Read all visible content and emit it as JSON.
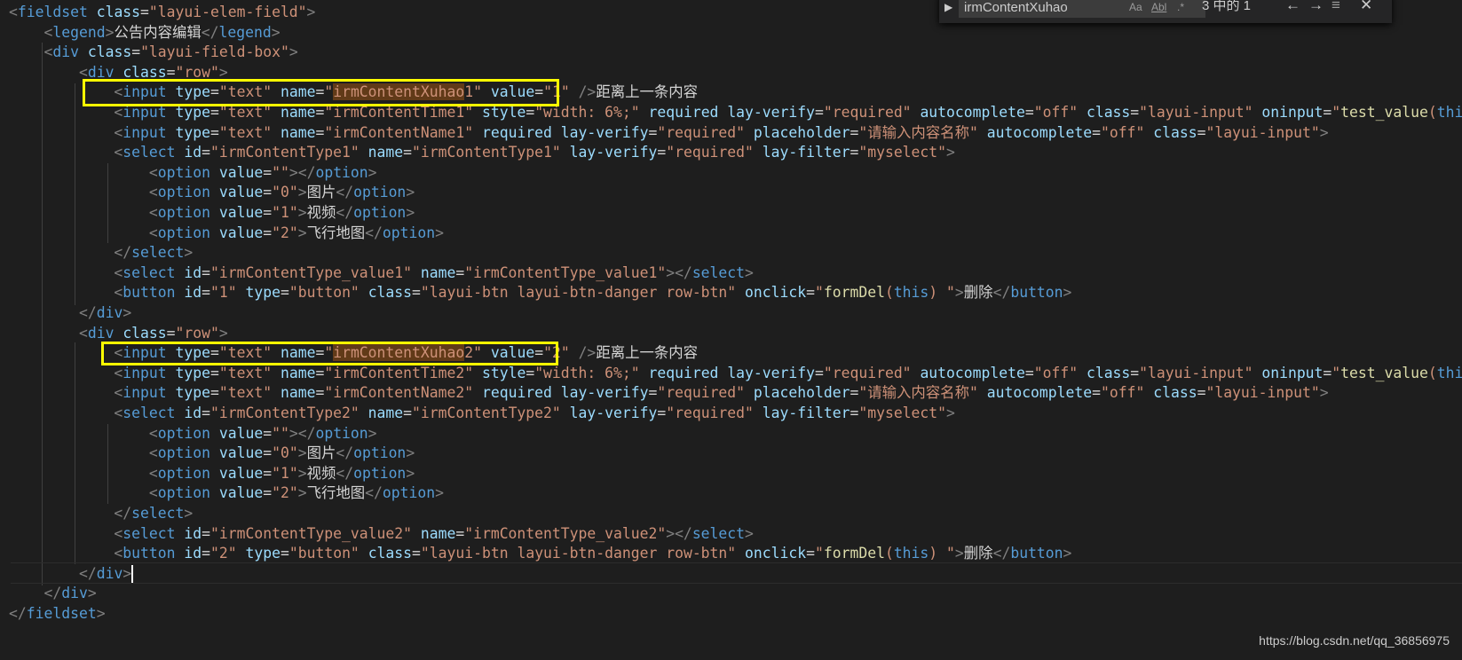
{
  "find_widget": {
    "search_value": "irmContentXuhao",
    "match_case_label": "Aa",
    "whole_word_label": "Abl",
    "regex_label": ".*",
    "result_count": "3 中的 1",
    "prev_icon": "arrow-left-icon",
    "next_icon": "arrow-right-icon",
    "selection_icon": "lines-icon",
    "close_icon": "close-icon"
  },
  "code_lines": [
    "<fieldset class=\"layui-elem-field\">",
    "    <legend>公告内容编辑</legend>",
    "    <div class=\"layui-field-box\">",
    "        <div class=\"row\">",
    "            <input type=\"text\" name=\"irmContentXuhao1\" value=\"1\" />距离上一条内容",
    "            <input type=\"text\" name=\"irmContentTime1\" style=\"width: 6%;\" required lay-verify=\"required\" autocomplete=\"off\" class=\"layui-input\" oninput=\"test_value(this)\">",
    "            <input type=\"text\" name=\"irmContentName1\" required lay-verify=\"required\" placeholder=\"请输入内容名称\" autocomplete=\"off\" class=\"layui-input\">",
    "            <select id=\"irmContentType1\" name=\"irmContentType1\" lay-verify=\"required\" lay-filter=\"myselect\">",
    "                <option value=\"\"></option>",
    "                <option value=\"0\">图片</option>",
    "                <option value=\"1\">视频</option>",
    "                <option value=\"2\">飞行地图</option>",
    "            </select>",
    "            <select id=\"irmContentType_value1\" name=\"irmContentType_value1\"></select>",
    "            <button id=\"1\" type=\"button\" class=\"layui-btn layui-btn-danger row-btn\" onclick=\"formDel(this) \">删除</button>",
    "        </div>",
    "        <div class=\"row\">",
    "            <input type=\"text\" name=\"irmContentXuhao2\" value=\"2\" />距离上一条内容",
    "            <input type=\"text\" name=\"irmContentTime2\" style=\"width: 6%;\" required lay-verify=\"required\" autocomplete=\"off\" class=\"layui-input\" oninput=\"test_value(this)\">",
    "            <input type=\"text\" name=\"irmContentName2\" required lay-verify=\"required\" placeholder=\"请输入内容名称\" autocomplete=\"off\" class=\"layui-input\">",
    "            <select id=\"irmContentType2\" name=\"irmContentType2\" lay-verify=\"required\" lay-filter=\"myselect\">",
    "                <option value=\"\"></option>",
    "                <option value=\"0\">图片</option>",
    "                <option value=\"1\">视频</option>",
    "                <option value=\"2\">飞行地图</option>",
    "            </select>",
    "            <select id=\"irmContentType_value2\" name=\"irmContentType_value2\"></select>",
    "            <button id=\"2\" type=\"button\" class=\"layui-btn layui-btn-danger row-btn\" onclick=\"formDel(this) \">删除</button>",
    "        </div>",
    "    </div>",
    "</fieldset>"
  ],
  "search_term": "irmContentXuhao",
  "watermark": "https://blog.csdn.net/qq_36856975",
  "colors": {
    "background": "#1e1e1e",
    "tag": "#569cd6",
    "attribute": "#9cdcfe",
    "string": "#ce9178",
    "function": "#dcdcaa",
    "match_highlight": "#613a18",
    "annotation_box": "#ffff00"
  }
}
